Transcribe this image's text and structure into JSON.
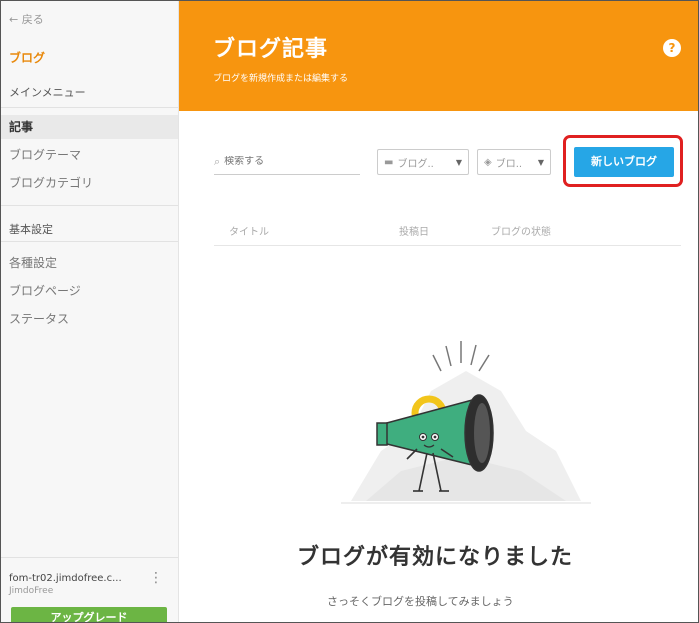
{
  "sidebar": {
    "back": "← 戻る",
    "title": "ブログ",
    "main_menu": "メインメニュー",
    "items": [
      {
        "label": "記事"
      },
      {
        "label": "ブログテーマ"
      },
      {
        "label": "ブログカテゴリ"
      }
    ],
    "basic_settings": "基本設定",
    "settings_items": [
      {
        "label": "各種設定"
      },
      {
        "label": "ブログページ"
      },
      {
        "label": "ステータス"
      }
    ],
    "site_name": "fom-tr02.jimdofree.c...",
    "plan": "JimdoFree",
    "upgrade": "アップグレード"
  },
  "header": {
    "title": "ブログ記事",
    "subtitle": "ブログを新規作成または編集する",
    "help": "?"
  },
  "toolbar": {
    "search_placeholder": "検索する",
    "dropdown1": "ブログ..",
    "dropdown2": "ブロ..",
    "new_blog": "新しいブログ"
  },
  "table": {
    "columns": [
      "タイトル",
      "投稿日",
      "ブログの状態"
    ]
  },
  "empty_state": {
    "title": "ブログが有効になりました",
    "subtitle": "さっそくブログを投稿してみましょう"
  },
  "colors": {
    "accent": "#f7950f",
    "primary_button": "#26a6e6",
    "upgrade": "#6cb544",
    "highlight": "#e02020"
  }
}
